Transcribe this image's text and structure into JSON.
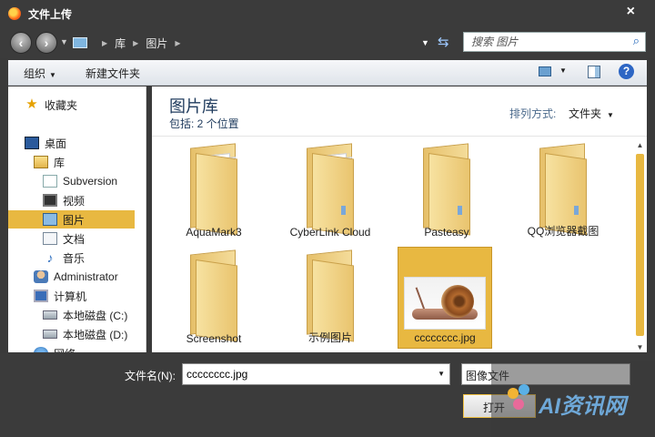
{
  "window": {
    "title": "文件上传",
    "close_glyph": "×"
  },
  "address": {
    "crumbs": [
      "库",
      "图片"
    ],
    "search_placeholder": "搜索 图片"
  },
  "toolbar": {
    "organize": "组织",
    "new_folder": "新建文件夹"
  },
  "sidebar": {
    "items": [
      {
        "label": "收藏夹",
        "icon": "favorites-star-icon"
      },
      {
        "label": "桌面",
        "icon": "desktop-icon"
      },
      {
        "label": "库",
        "icon": "library-icon"
      },
      {
        "label": "Subversion",
        "icon": "subversion-icon"
      },
      {
        "label": "视频",
        "icon": "video-icon"
      },
      {
        "label": "图片",
        "icon": "pictures-icon",
        "selected": true
      },
      {
        "label": "文档",
        "icon": "documents-icon"
      },
      {
        "label": "音乐",
        "icon": "music-icon"
      },
      {
        "label": "Administrator",
        "icon": "user-icon"
      },
      {
        "label": "计算机",
        "icon": "computer-icon"
      },
      {
        "label": "本地磁盘 (C:)",
        "icon": "disk-icon"
      },
      {
        "label": "本地磁盘 (D:)",
        "icon": "disk-icon"
      },
      {
        "label": "网络",
        "icon": "network-icon"
      }
    ]
  },
  "library": {
    "title": "图片库",
    "subtitle": "包括:  2 个位置",
    "arrange_label": "排列方式:",
    "arrange_value": "文件夹"
  },
  "files": [
    {
      "name": "AquaMark3",
      "type": "folder"
    },
    {
      "name": "CyberLink Cloud",
      "type": "folder"
    },
    {
      "name": "Pasteasy",
      "type": "folder"
    },
    {
      "name": "QQ浏览器截图",
      "type": "folder"
    },
    {
      "name": "Screenshot",
      "type": "folder"
    },
    {
      "name": "示例图片",
      "type": "folder"
    },
    {
      "name": "cccccccc.jpg",
      "type": "image",
      "selected": true
    }
  ],
  "bottom": {
    "filename_label": "文件名(N):",
    "filename_value": "cccccccc.jpg",
    "filetype_value": "图像文件",
    "open_button": "打开"
  },
  "watermark": {
    "text": "AI资讯网"
  },
  "colors": {
    "selection": "#e8b841",
    "chrome": "#3b3b3b",
    "link_blue": "#1e3a5c"
  }
}
